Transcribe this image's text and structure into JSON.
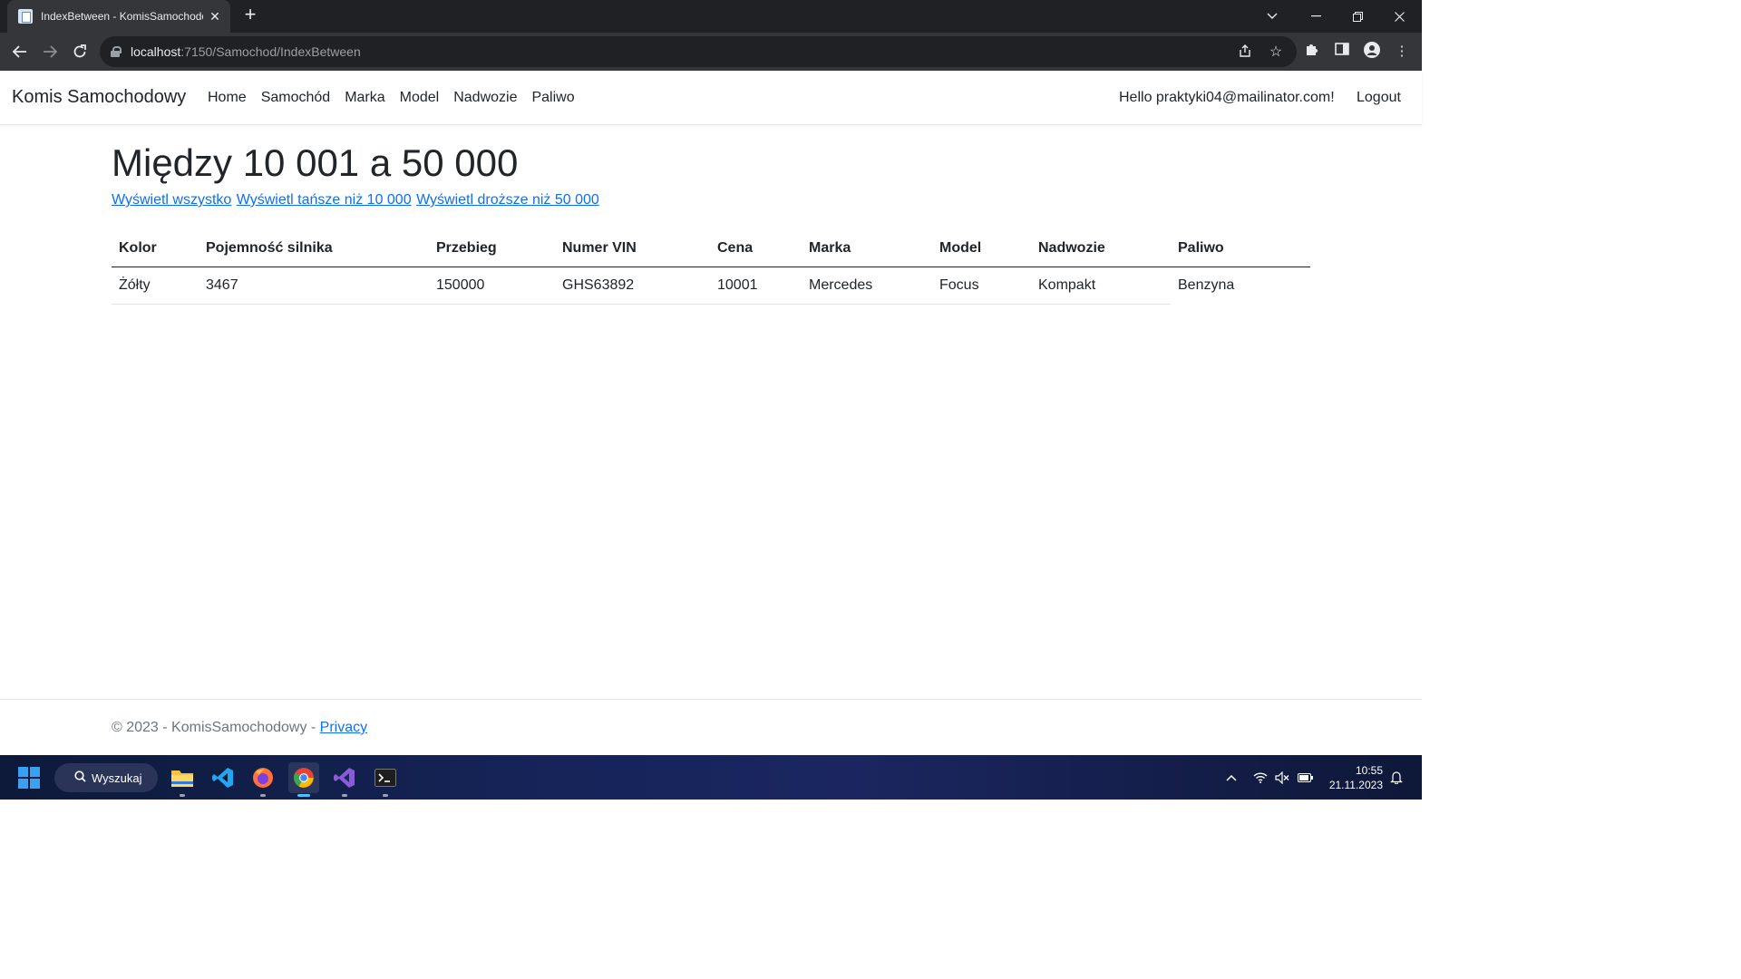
{
  "browser": {
    "tab_title": "IndexBetween - KomisSamochodowy",
    "url_host": "localhost",
    "url_path": ":7150/Samochod/IndexBetween"
  },
  "site": {
    "brand": "Komis Samochodowy",
    "nav": [
      "Home",
      "Samochód",
      "Marka",
      "Model",
      "Nadwozie",
      "Paliwo"
    ],
    "greeting": "Hello praktyki04@mailinator.com!",
    "logout": "Logout"
  },
  "main": {
    "title": "Między 10 001 a 50 000",
    "filters": [
      "Wyświetl wszystko",
      "Wyświetl tańsze niż 10 000",
      "Wyświetl droższe niż 50 000"
    ],
    "table": {
      "headers": [
        "Kolor",
        "Pojemność silnika",
        "Przebieg",
        "Numer VIN",
        "Cena",
        "Marka",
        "Model",
        "Nadwozie",
        "Paliwo"
      ],
      "rows": [
        [
          "Żółty",
          "3467",
          "150000",
          "GHS63892",
          "10001",
          "Mercedes",
          "Focus",
          "Kompakt",
          "Benzyna"
        ]
      ]
    }
  },
  "footer": {
    "text": "© 2023 - KomisSamochodowy - ",
    "privacy": "Privacy"
  },
  "taskbar": {
    "search": "Wyszukaj",
    "time": "10:55",
    "date": "21.11.2023"
  },
  "colors": {
    "link": "#0d6efd",
    "text": "#212529",
    "chrome_dark": "#202124",
    "chrome_toolbar": "#35363a"
  }
}
